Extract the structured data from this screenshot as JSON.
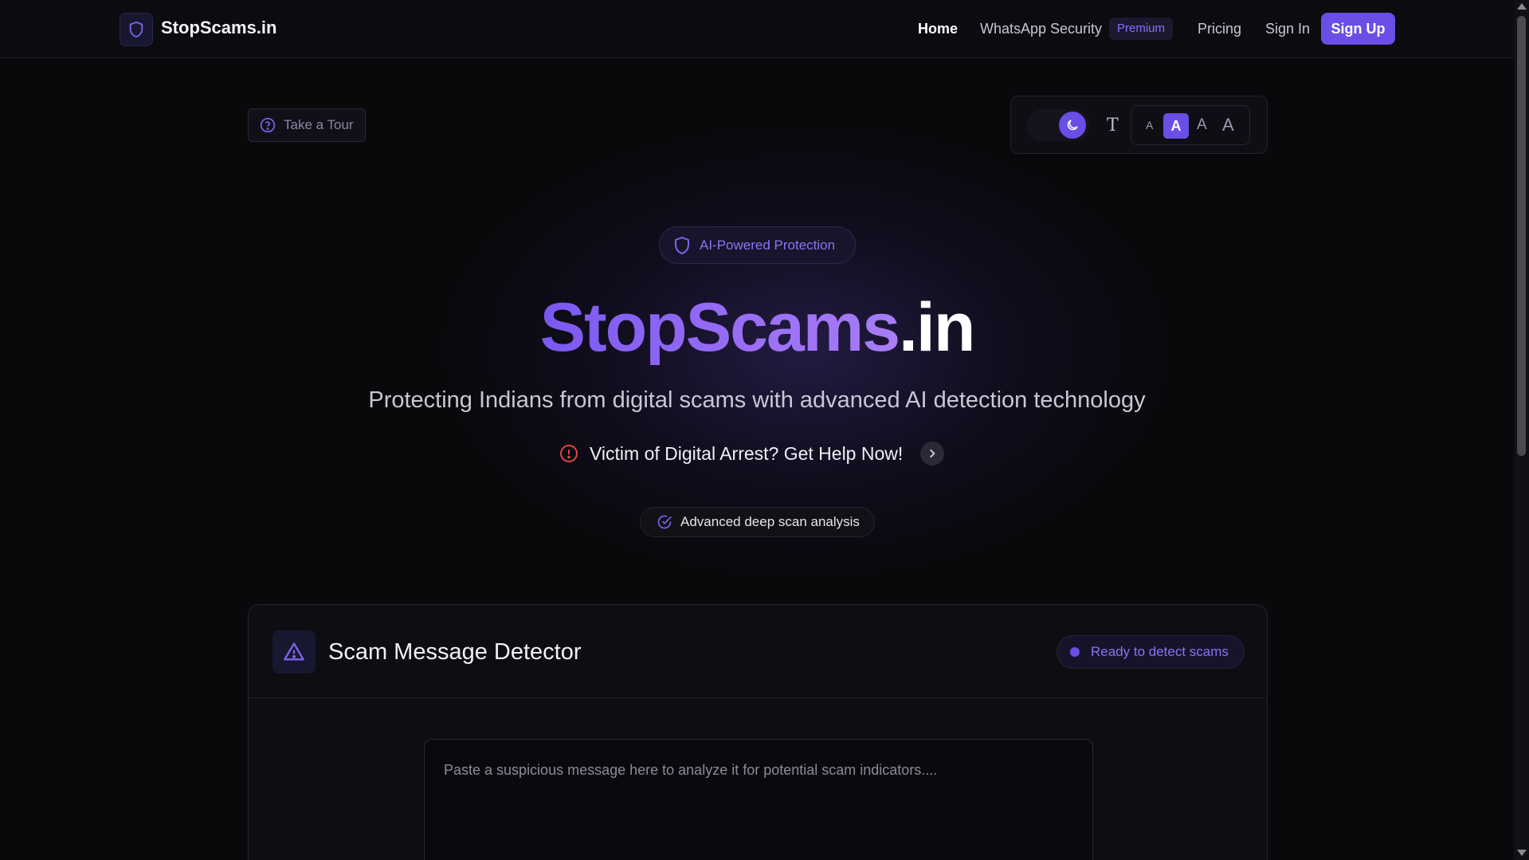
{
  "colors": {
    "accent": "#6a4ee6",
    "background": "#09090c",
    "alert": "#e0483e"
  },
  "nav": {
    "brand": "StopScams.in",
    "home": "Home",
    "whatsapp": "WhatsApp Security",
    "premium": "Premium",
    "pricing": "Pricing",
    "signin": "Sign In",
    "signup": "Sign Up"
  },
  "tour": {
    "label": "Take a Tour"
  },
  "controls": {
    "text_icon": "T",
    "sizes": [
      "A",
      "A",
      "A",
      "A"
    ],
    "selected_size_index": 1,
    "theme": "dark"
  },
  "hero": {
    "badge": "AI-Powered Protection",
    "title_main": "StopScams",
    "title_tld": ".in",
    "subtitle": "Protecting Indians from digital scams with advanced AI detection technology",
    "victim": "Victim of Digital Arrest? Get Help Now!",
    "feature": "Advanced deep scan analysis"
  },
  "detector": {
    "title": "Scam Message Detector",
    "status": "Ready to detect scams",
    "placeholder": "Paste a suspicious message here to analyze it for potential scam indicators...."
  },
  "icons": {
    "logo": "shield-icon",
    "tour": "help-circle-icon",
    "theme": "moon-icon",
    "badge": "shield-icon",
    "victim": "alert-circle-icon",
    "victim_arrow": "chevron-right-icon",
    "feature": "check-circle-icon",
    "detector": "warning-triangle-icon"
  }
}
